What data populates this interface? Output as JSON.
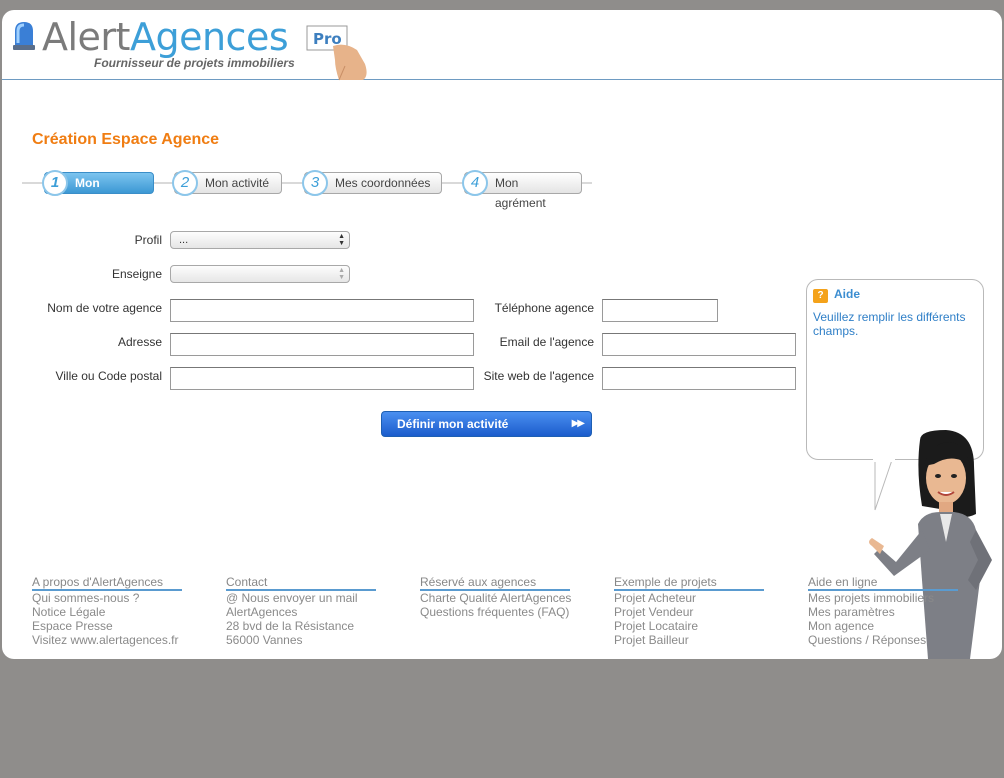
{
  "header": {
    "logo_alert": "Alert",
    "logo_agences": "Agences",
    "tagline": "Fournisseur de projets immobiliers",
    "badge": "Pro"
  },
  "page_title": "Création Espace Agence",
  "steps": [
    {
      "num": "1",
      "label": "Mon agence",
      "active": true
    },
    {
      "num": "2",
      "label": "Mon activité"
    },
    {
      "num": "3",
      "label": "Mes coordonnées"
    },
    {
      "num": "4",
      "label": "Mon agrément"
    }
  ],
  "form": {
    "profil_label": "Profil",
    "profil_value": "...",
    "enseigne_label": "Enseigne",
    "enseigne_value": "",
    "nom_label": "Nom de votre agence",
    "nom_value": "",
    "adresse_label": "Adresse",
    "adresse_value": "",
    "ville_label": "Ville ou Code postal",
    "ville_value": "",
    "telephone_label": "Téléphone agence",
    "telephone_value": "",
    "email_label": "Email de l'agence",
    "email_value": "",
    "site_label": "Site web de l'agence",
    "site_value": "",
    "submit_label": "Définir mon activité"
  },
  "help": {
    "title": "Aide",
    "text": "Veuillez remplir les différents champs."
  },
  "footer": [
    {
      "heading": "A propos d'AlertAgences",
      "links": [
        "Qui sommes-nous ?",
        "Notice Légale",
        "Espace Presse",
        "Visitez www.alertagences.fr"
      ]
    },
    {
      "heading": "Contact",
      "links": [
        "@ Nous envoyer un mail",
        "AlertAgences",
        "28 bvd de la Résistance",
        "56000 Vannes"
      ]
    },
    {
      "heading": "Réservé aux agences",
      "links": [
        "Charte Qualité AlertAgences",
        "Questions fréquentes (FAQ)"
      ]
    },
    {
      "heading": "Exemple de projets",
      "links": [
        "Projet Acheteur",
        "Projet Vendeur",
        "Projet Locataire",
        "Projet Bailleur"
      ]
    },
    {
      "heading": "Aide en ligne",
      "links": [
        "Mes projets immobiliers",
        "Mes paramètres",
        "Mon agence",
        "Questions / Réponses"
      ]
    }
  ],
  "colors": {
    "accent_orange": "#f07d12",
    "brand_blue": "#3d9fd8",
    "cta_blue": "#1b5ccc",
    "background": "#8f8d8b"
  }
}
